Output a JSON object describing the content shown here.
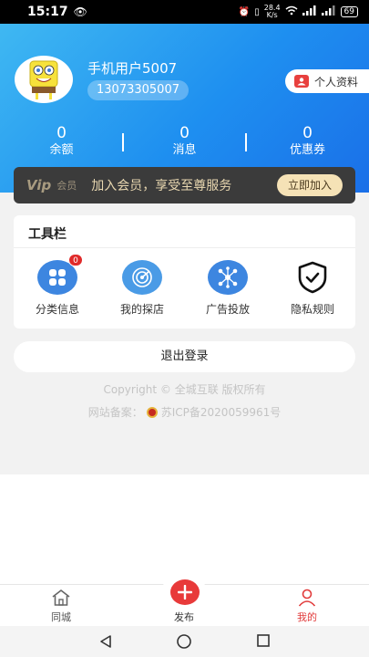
{
  "status": {
    "time": "15:17",
    "net_speed_top": "28.4",
    "net_speed_bottom": "K/s",
    "battery": "69"
  },
  "user": {
    "name": "手机用户5007",
    "phone": "13073305007",
    "profile_label": "个人资料"
  },
  "stats": [
    {
      "value": "0",
      "label": "余额"
    },
    {
      "value": "0",
      "label": "消息"
    },
    {
      "value": "0",
      "label": "优惠券"
    }
  ],
  "vip": {
    "logo": "Vip",
    "tag": "会员",
    "text": "加入会员，享受至尊服务",
    "button": "立即加入"
  },
  "toolbar": {
    "title": "工具栏",
    "tools": [
      {
        "label": "分类信息",
        "badge": "0",
        "icon": "grid-icon"
      },
      {
        "label": "我的探店",
        "icon": "radar-icon"
      },
      {
        "label": "广告投放",
        "icon": "network-icon"
      },
      {
        "label": "隐私规则",
        "icon": "shield-check-icon"
      }
    ]
  },
  "logout_label": "退出登录",
  "footer": {
    "copyright": "Copyright © 全城互联 版权所有",
    "icp_prefix": "网站备案：",
    "icp": "苏ICP备2020059961号"
  },
  "tabbar": [
    {
      "label": "同城",
      "icon": "home-icon",
      "active": false
    },
    {
      "label": "发布",
      "icon": "plus-icon",
      "active": false
    },
    {
      "label": "我的",
      "icon": "user-icon",
      "active": true
    }
  ],
  "colors": {
    "header_start": "#3fb8f2",
    "header_end": "#1a6fe8",
    "accent_red": "#e83a3a",
    "vip_bg": "#3b3b3b",
    "vip_btn": "#f5e2b6"
  }
}
